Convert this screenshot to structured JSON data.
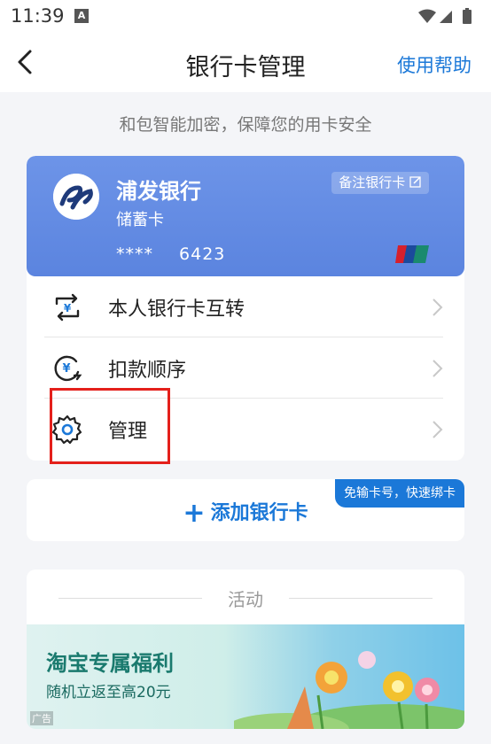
{
  "status_bar": {
    "time": "11:39",
    "notification_icon": "A"
  },
  "nav": {
    "title": "银行卡管理",
    "help_label": "使用帮助"
  },
  "slogan": "和包智能加密，保障您的用卡安全",
  "card": {
    "bank_name": "浦发银行",
    "card_type": "储蓄卡",
    "card_mask": "****",
    "card_last4": "6423",
    "note_button": "备注银行卡",
    "accent_color": "#5b84df"
  },
  "menu": [
    {
      "label": "本人银行卡互转",
      "icon": "transfer-icon"
    },
    {
      "label": "扣款顺序",
      "icon": "deduction-order-icon"
    },
    {
      "label": "管理",
      "icon": "gear-icon"
    }
  ],
  "add_card": {
    "label": "添加银行卡",
    "promo": "免输卡号，快速绑卡"
  },
  "activity": {
    "title": "活动",
    "banner_title": "淘宝专属福利",
    "banner_sub": "随机立返至高20元",
    "ad_tag": "广告"
  }
}
